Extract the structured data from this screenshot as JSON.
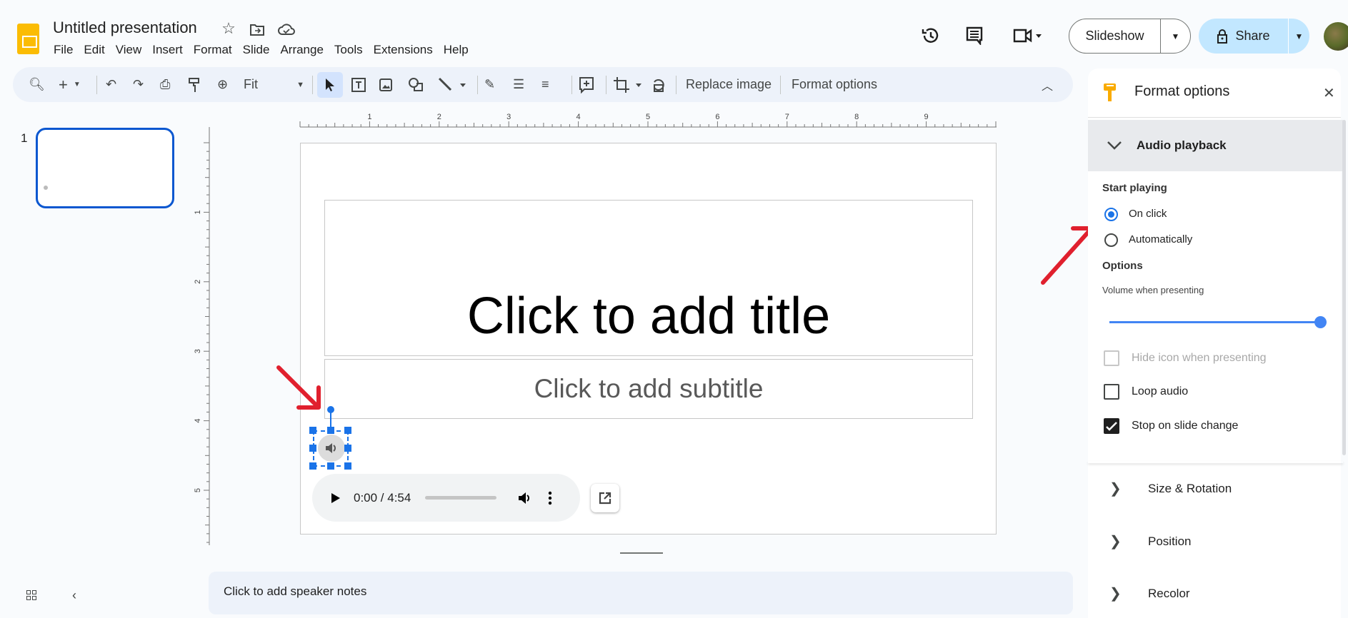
{
  "header": {
    "title": "Untitled presentation",
    "menu": [
      "File",
      "Edit",
      "View",
      "Insert",
      "Format",
      "Slide",
      "Arrange",
      "Tools",
      "Extensions",
      "Help"
    ],
    "slideshow_label": "Slideshow",
    "share_label": "Share"
  },
  "toolbar": {
    "zoom_value": "Fit",
    "replace_image": "Replace image",
    "format_options": "Format options"
  },
  "filmstrip": {
    "slide_number": "1"
  },
  "rulers": {
    "horizontal": [
      "1",
      "2",
      "3",
      "4",
      "5",
      "6",
      "7",
      "8",
      "9"
    ],
    "vertical": [
      "1",
      "2",
      "3",
      "4",
      "5"
    ]
  },
  "slide": {
    "title_placeholder": "Click to add title",
    "subtitle_placeholder": "Click to add subtitle",
    "audio_player": {
      "time": "0:00 / 4:54",
      "progress": 0
    }
  },
  "notes": {
    "placeholder": "Click to add speaker notes"
  },
  "panel": {
    "title": "Format options",
    "audio_section": "Audio playback",
    "start_playing_label": "Start playing",
    "start_options": [
      {
        "label": "On click",
        "selected": true
      },
      {
        "label": "Automatically",
        "selected": false
      }
    ],
    "options_label": "Options",
    "volume_label": "Volume when presenting",
    "volume_percent": 100,
    "checkboxes": [
      {
        "label": "Hide icon when presenting",
        "checked": false,
        "disabled": true
      },
      {
        "label": "Loop audio",
        "checked": false,
        "disabled": false
      },
      {
        "label": "Stop on slide change",
        "checked": true,
        "disabled": false
      }
    ],
    "collapsed_sections": [
      "Size & Rotation",
      "Position",
      "Recolor"
    ]
  },
  "colors": {
    "accent": "#1a73e8",
    "share_bg": "#c2e7ff",
    "toolbar_bg": "#edf2fa",
    "annotation_arrow": "#e0202e",
    "logo": "#fbbc04"
  }
}
